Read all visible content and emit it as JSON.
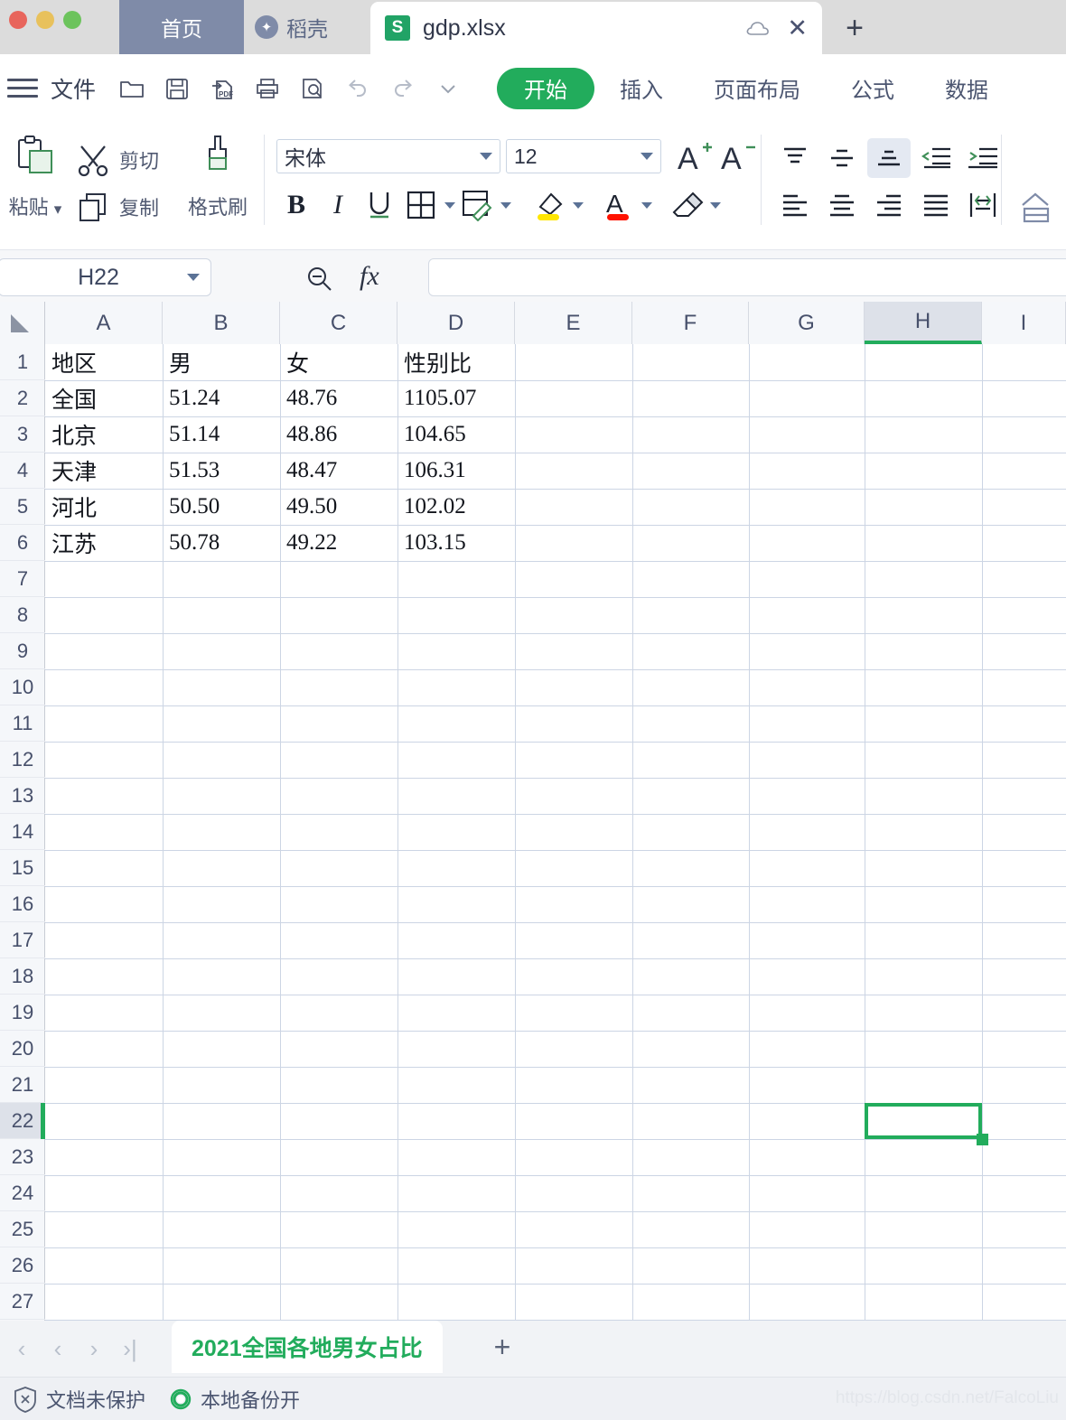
{
  "window": {
    "traffic_lights": [
      "close",
      "minimize",
      "maximize"
    ]
  },
  "tabbar": {
    "home_tab": "首页",
    "docer_tab": "稻壳",
    "docer_icon": "leaf-icon",
    "file_tab": {
      "name": "gdp.xlsx",
      "app_icon": "wps-spreadsheet-icon",
      "cloud_icon": "cloud-icon",
      "close_icon": "close-icon"
    },
    "new_tab_icon": "plus-icon"
  },
  "menubar": {
    "menu_icon": "hamburger-icon",
    "file_label": "文件",
    "quick_access": [
      {
        "name": "open-icon",
        "title": "打开"
      },
      {
        "name": "save-icon",
        "title": "保存"
      },
      {
        "name": "export-pdf-icon",
        "title": "输出为PDF"
      },
      {
        "name": "print-icon",
        "title": "打印"
      },
      {
        "name": "print-preview-icon",
        "title": "打印预览"
      },
      {
        "name": "undo-icon",
        "title": "撤销"
      },
      {
        "name": "redo-icon",
        "title": "恢复"
      },
      {
        "name": "more-icon",
        "title": "更多"
      }
    ],
    "ribbon_tabs": [
      {
        "label": "开始",
        "active": true
      },
      {
        "label": "插入",
        "active": false
      },
      {
        "label": "页面布局",
        "active": false
      },
      {
        "label": "公式",
        "active": false
      },
      {
        "label": "数据",
        "active": false
      }
    ]
  },
  "ribbon": {
    "clipboard": {
      "paste_label": "粘贴",
      "paste_icon": "paste-icon",
      "cut_label": "剪切",
      "cut_icon": "scissors-icon",
      "copy_label": "复制",
      "copy_icon": "copy-icon",
      "format_painter_label": "格式刷",
      "format_painter_icon": "format-painter-icon"
    },
    "font": {
      "family_value": "宋体",
      "size_value": "12",
      "grow_icon": "increase-font-size-icon",
      "shrink_icon": "decrease-font-size-icon",
      "bold_label": "B",
      "italic_label": "I",
      "underline_label": "U",
      "borders_icon": "borders-icon",
      "cell_style_icon": "cell-style-icon",
      "fill_color_icon": "fill-color-icon",
      "fill_color": "#ffe600",
      "font_color_icon": "font-color-icon",
      "font_color": "#ff1200",
      "clear_format_icon": "clear-format-icon"
    },
    "alignment": {
      "align_top_icon": "align-top-icon",
      "align_middle_icon": "align-middle-icon",
      "align_bottom_icon": "align-bottom-icon",
      "decrease_indent_icon": "decrease-indent-icon",
      "increase_indent_icon": "increase-indent-icon",
      "align_left_icon": "align-left-icon",
      "align_center_icon": "align-center-icon",
      "align_right_icon": "align-right-icon",
      "justify_icon": "justify-icon",
      "wrap_text_icon": "wrap-text-icon",
      "merge_icon": "merge-cells-icon",
      "selected": "align-bottom-icon"
    }
  },
  "formula_bar": {
    "name_box_value": "H22",
    "zoom_icon": "zoom-out-icon",
    "fx_label": "fx",
    "input_value": "",
    "input_placeholder": ""
  },
  "grid": {
    "columns": [
      "A",
      "B",
      "C",
      "D",
      "E",
      "F",
      "G",
      "H",
      "I"
    ],
    "selected_column": "H",
    "selected_row": 22,
    "selected_cell": "H22",
    "rows": [
      1,
      2,
      3,
      4,
      5,
      6,
      7,
      8,
      9,
      10,
      11,
      12,
      13,
      14,
      15,
      16,
      17,
      18,
      19,
      20,
      21,
      22,
      23,
      24,
      25,
      26,
      27
    ],
    "data": [
      {
        "row": 1,
        "A": "地区",
        "B": "男",
        "C": "女",
        "D": "性别比"
      },
      {
        "row": 2,
        "A": "全国",
        "B": "51.24",
        "C": "48.76",
        "D": "1105.07"
      },
      {
        "row": 3,
        "A": "北京",
        "B": "51.14",
        "C": "48.86",
        "D": "104.65"
      },
      {
        "row": 4,
        "A": "天津",
        "B": "51.53",
        "C": "48.47",
        "D": "106.31"
      },
      {
        "row": 5,
        "A": "河北",
        "B": "50.50",
        "C": "49.50",
        "D": "102.02"
      },
      {
        "row": 6,
        "A": "江苏",
        "B": "50.78",
        "C": "49.22",
        "D": "103.15"
      }
    ]
  },
  "sheetbar": {
    "nav_first_icon": "nav-first-icon",
    "nav_prev_icon": "nav-prev-icon",
    "nav_next_icon": "nav-next-icon",
    "nav_last_icon": "nav-last-icon",
    "sheets": [
      {
        "name": "2021全国各地男女占比",
        "active": true
      }
    ],
    "add_sheet_icon": "add-sheet-icon"
  },
  "statusbar": {
    "protection_icon": "shield-unprotected-icon",
    "protection_label": "文档未保护",
    "backup_icon": "backup-on-icon",
    "backup_label": "本地备份开",
    "watermark": "https://blog.csdn.net/FalcoLiu"
  },
  "colors": {
    "accent_green": "#22ac5c",
    "tab_blue_gray": "#7f8ba8",
    "header_text": "#47506b"
  }
}
